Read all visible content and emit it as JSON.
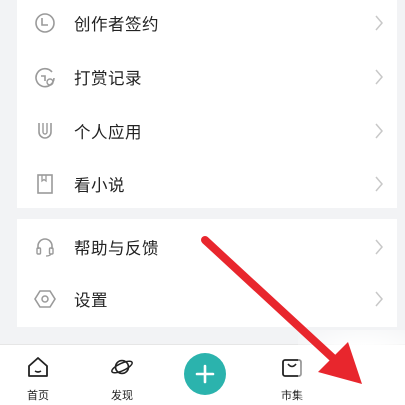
{
  "menu_group_1": [
    {
      "label": "创作者签约",
      "icon": "creator-sign-icon"
    },
    {
      "label": "打赏记录",
      "icon": "reward-record-icon"
    },
    {
      "label": "个人应用",
      "icon": "personal-app-icon"
    },
    {
      "label": "看小说",
      "icon": "novel-icon"
    }
  ],
  "menu_group_2": [
    {
      "label": "帮助与反馈",
      "icon": "headset-icon"
    },
    {
      "label": "设置",
      "icon": "settings-icon"
    }
  ],
  "tabbar": {
    "home": {
      "label": "首页",
      "icon": "home-icon"
    },
    "discover": {
      "label": "发现",
      "icon": "planet-icon"
    },
    "create": {
      "icon": "plus-icon"
    },
    "market": {
      "label": "市集",
      "icon": "shopping-bag-icon"
    }
  },
  "colors": {
    "accent": "#2bb3ad",
    "annotation_arrow": "#e8262d",
    "icon_gray": "#9a9a9a"
  }
}
